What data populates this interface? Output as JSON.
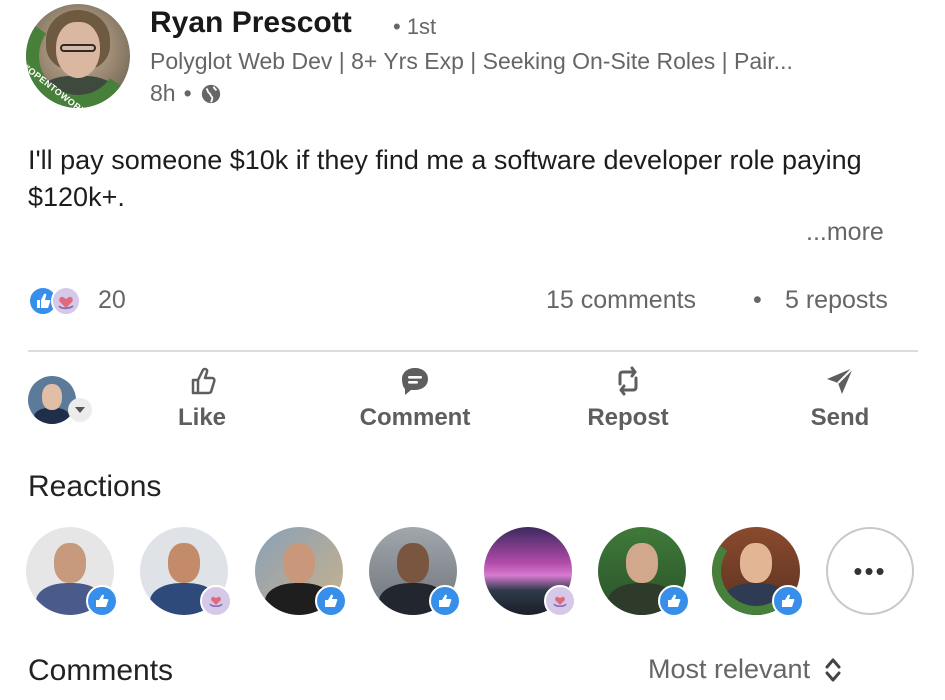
{
  "author": {
    "name": "Ryan Prescott",
    "degree": "• 1st",
    "headline": "Polyglot Web Dev | 8+ Yrs Exp | Seeking On-Site Roles | Pair...",
    "time": "8h",
    "time_sep": "•",
    "visibility_icon": "globe-icon",
    "badge_text": "#OPENTOWORK",
    "badge_color": "#47803b"
  },
  "post": {
    "text": "I'll pay someone $10k if they find me a software developer role paying $120k+.",
    "more_label": "...more"
  },
  "social": {
    "reaction_count": "20",
    "comments": "15 comments",
    "separator": "•",
    "reposts": "5 reposts"
  },
  "actions": {
    "like": "Like",
    "comment": "Comment",
    "repost": "Repost",
    "send": "Send"
  },
  "reactions": {
    "title": "Reactions",
    "people": [
      {
        "reaction": "like"
      },
      {
        "reaction": "love"
      },
      {
        "reaction": "like"
      },
      {
        "reaction": "like"
      },
      {
        "reaction": "love"
      },
      {
        "reaction": "like"
      },
      {
        "reaction": "like",
        "badge_text": "#OPENTOWORK"
      }
    ],
    "more_label": "•••"
  },
  "comments_section": {
    "title": "Comments",
    "sort_label": "Most relevant"
  },
  "colors": {
    "like_blue": "#378fe9",
    "love_lilac": "#d6c8e8",
    "text_gray": "#666666",
    "open_to_work_green": "#47803b"
  }
}
